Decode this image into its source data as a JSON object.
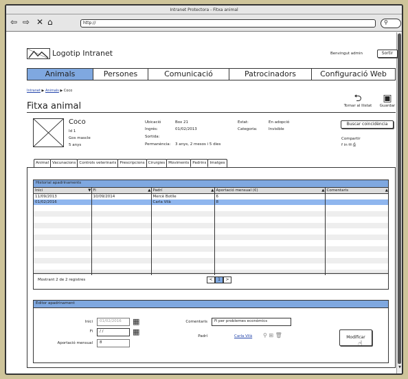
{
  "window": {
    "title": "Intranet Protectora - Fitxa animal",
    "url": "http://"
  },
  "header": {
    "logo": "Logotip Intranet",
    "welcome": "Benvingut admin",
    "logout": "Sortir"
  },
  "nav": [
    {
      "label": "Animals",
      "active": true
    },
    {
      "label": "Persones"
    },
    {
      "label": "Comunicació"
    },
    {
      "label": "Patrocinadors"
    },
    {
      "label": "Configuració Web"
    }
  ],
  "breadcrumb": {
    "a": "Intranet",
    "b": "Animals",
    "c": "Coco"
  },
  "page_title": "Fitxa animal",
  "actions": {
    "back": "Tornar al llistat",
    "save": "Guardar"
  },
  "animal": {
    "name": "Coco",
    "id": "Id 1",
    "type": "Gos mascle",
    "age": "5 anys",
    "ubicacio_label": "Ubicació",
    "ubicacio": "Box 21",
    "ingres_label": "Ingrés:",
    "ingres": "01/02/2013",
    "sortida_label": "Sortida:",
    "permanencia_label": "Permanència:",
    "permanencia": "3 anys, 2 mesos i 5 dies",
    "estat_label": "Estat:",
    "estat": "En adopció",
    "categoria_label": "Categoria:",
    "categoria": "Invisible",
    "match_button": "Buscar coincidència",
    "share_label": "Compartir",
    "share_icons": "f  in  ✉  ⎙"
  },
  "subtabs": [
    "Animal",
    "Vacunacions",
    "Controls veterinaris",
    "Prescripcions",
    "Cirurgies",
    "Moviments",
    "Padrins",
    "Imatges"
  ],
  "active_subtab": "Padrins",
  "history": {
    "title": "Historial apadrinaments",
    "columns": [
      "Inici",
      "Fi",
      "Padrí",
      "Aportació mensual (€)",
      "Comentaris"
    ],
    "rows": [
      [
        "11/09/2013",
        "10/09/2014",
        "Mercè Botlle",
        "6",
        ""
      ],
      [
        "01/02/2016",
        "",
        "Carla Vilà",
        "8",
        ""
      ]
    ],
    "footer": "Mostrant 2 de 2 registres",
    "pager": [
      "<",
      "1",
      ">"
    ]
  },
  "editor": {
    "title": "Editor apadrinament",
    "inici_label": "Inici",
    "inici_value": "01/02/2016",
    "fi_label": "Fi",
    "fi_value": "/ /",
    "aportacio_label": "Aportació mensual",
    "aportacio_value": "8",
    "comentaris_label": "Comentaris",
    "comentaris_value": "Fi per problemes econòmics",
    "padri_label": "Padrí",
    "padri_value": "Carla Vilà",
    "modify_button": "Modificar"
  },
  "colors": {
    "accent": "#7fa8e0",
    "selected_row": "#8fb6ee",
    "background": "#cec49a"
  }
}
